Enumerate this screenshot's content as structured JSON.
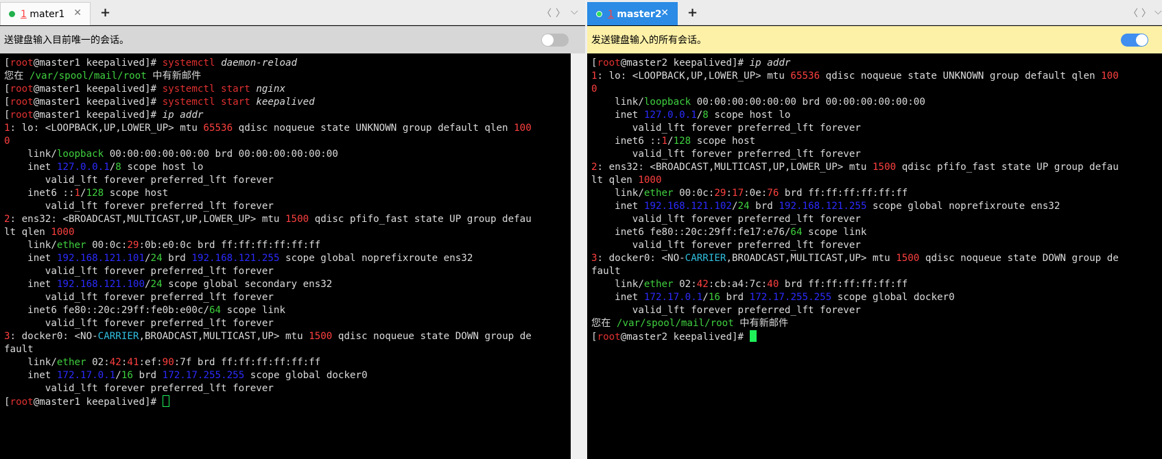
{
  "left": {
    "tab": {
      "num": "1",
      "name": "mater1"
    },
    "tab_close": "✕",
    "tab_add": "+",
    "nav": {
      "prev": "〈",
      "next": "〉",
      "menu": "⌵"
    },
    "broadcast_text": "送键盘输入目前唯一的会话。",
    "broadcast_on": false,
    "prompt": {
      "user": "root",
      "host": "@master1 keepalived"
    },
    "lines": [
      [
        [
          "br",
          "["
        ],
        [
          "root",
          "root"
        ],
        [
          "br",
          "@master1 keepalived]# "
        ],
        [
          "cmd",
          "systemctl "
        ],
        [
          "arg",
          "daemon-reload"
        ]
      ],
      [
        [
          "t",
          "您在 "
        ],
        [
          "grn",
          "/var/spool/mail/root"
        ],
        [
          "t",
          " 中有新邮件"
        ]
      ],
      [
        [
          "br",
          "["
        ],
        [
          "root",
          "root"
        ],
        [
          "br",
          "@master1 keepalived]# "
        ],
        [
          "cmd",
          "systemctl start "
        ],
        [
          "arg",
          "nginx"
        ]
      ],
      [
        [
          "br",
          "["
        ],
        [
          "root",
          "root"
        ],
        [
          "br",
          "@master1 keepalived]# "
        ],
        [
          "cmd",
          "systemctl start "
        ],
        [
          "arg",
          "keepalived"
        ]
      ],
      [
        [
          "br",
          "["
        ],
        [
          "root",
          "root"
        ],
        [
          "br",
          "@master1 keepalived]# "
        ],
        [
          "arg",
          "ip addr"
        ]
      ],
      [
        [
          "num",
          "1"
        ],
        [
          "t",
          ": lo: <LOOPBACK,UP,LOWER_UP> mtu "
        ],
        [
          "num",
          "65536"
        ],
        [
          "t",
          " qdisc noqueue state UNKNOWN group default qlen "
        ],
        [
          "num",
          "100"
        ]
      ],
      [
        [
          "num",
          "0"
        ]
      ],
      [
        [
          "t",
          "    link/"
        ],
        [
          "grn",
          "loopback"
        ],
        [
          "t",
          " 00:00:00:00:00:00 brd 00:00:00:00:00:00"
        ]
      ],
      [
        [
          "t",
          "    inet "
        ],
        [
          "blu",
          "127.0.0.1"
        ],
        [
          "t",
          "/"
        ],
        [
          "grn",
          "8"
        ],
        [
          "t",
          " scope host lo"
        ]
      ],
      [
        [
          "t",
          "       valid_lft forever preferred_lft forever"
        ]
      ],
      [
        [
          "t",
          "    inet6 ::"
        ],
        [
          "num",
          "1"
        ],
        [
          "t",
          "/"
        ],
        [
          "grn",
          "128"
        ],
        [
          "t",
          " scope host"
        ]
      ],
      [
        [
          "t",
          "       valid_lft forever preferred_lft forever"
        ]
      ],
      [
        [
          "num",
          "2"
        ],
        [
          "t",
          ": ens32: <BROADCAST,MULTICAST,UP,LOWER_UP> mtu "
        ],
        [
          "num",
          "1500"
        ],
        [
          "t",
          " qdisc pfifo_fast state UP group defau"
        ]
      ],
      [
        [
          "t",
          "lt qlen "
        ],
        [
          "num",
          "1000"
        ]
      ],
      [
        [
          "t",
          "    link/"
        ],
        [
          "grn",
          "ether"
        ],
        [
          "t",
          " 00:0c:"
        ],
        [
          "num",
          "29"
        ],
        [
          "t",
          ":0b:e0:0c brd ff:ff:ff:ff:ff:ff"
        ]
      ],
      [
        [
          "t",
          "    inet "
        ],
        [
          "blu",
          "192.168.121.101"
        ],
        [
          "t",
          "/"
        ],
        [
          "grn",
          "24"
        ],
        [
          "t",
          " brd "
        ],
        [
          "blu",
          "192.168.121.255"
        ],
        [
          "t",
          " scope global noprefixroute ens32"
        ]
      ],
      [
        [
          "t",
          "       valid_lft forever preferred_lft forever"
        ]
      ],
      [
        [
          "t",
          "    inet "
        ],
        [
          "blu",
          "192.168.121.100"
        ],
        [
          "t",
          "/"
        ],
        [
          "grn",
          "24"
        ],
        [
          "t",
          " scope global secondary ens32"
        ]
      ],
      [
        [
          "t",
          "       valid_lft forever preferred_lft forever"
        ]
      ],
      [
        [
          "t",
          "    inet6 fe80::20c:29ff:fe0b:e00c/"
        ],
        [
          "grn",
          "64"
        ],
        [
          "t",
          " scope link"
        ]
      ],
      [
        [
          "t",
          "       valid_lft forever preferred_lft forever"
        ]
      ],
      [
        [
          "num",
          "3"
        ],
        [
          "t",
          ": docker0: <NO-"
        ],
        [
          "cyan",
          "CARRIER"
        ],
        [
          "t",
          ",BROADCAST,MULTICAST,UP> mtu "
        ],
        [
          "num",
          "1500"
        ],
        [
          "t",
          " qdisc noqueue state DOWN group de"
        ]
      ],
      [
        [
          "t",
          "fault"
        ]
      ],
      [
        [
          "t",
          "    link/"
        ],
        [
          "grn",
          "ether"
        ],
        [
          "t",
          " 02:"
        ],
        [
          "num",
          "42"
        ],
        [
          "t",
          ":"
        ],
        [
          "num",
          "41"
        ],
        [
          "t",
          ":ef:"
        ],
        [
          "num",
          "90"
        ],
        [
          "t",
          ":7f brd ff:ff:ff:ff:ff:ff"
        ]
      ],
      [
        [
          "t",
          "    inet "
        ],
        [
          "blu",
          "172.17.0.1"
        ],
        [
          "t",
          "/"
        ],
        [
          "grn",
          "16"
        ],
        [
          "t",
          " brd "
        ],
        [
          "blu",
          "172.17.255.255"
        ],
        [
          "t",
          " scope global docker0"
        ]
      ],
      [
        [
          "t",
          "       valid_lft forever preferred_lft forever"
        ]
      ],
      [
        [
          "br",
          "["
        ],
        [
          "root",
          "root"
        ],
        [
          "br",
          "@master1 keepalived]# "
        ],
        [
          "cursor",
          ""
        ]
      ]
    ]
  },
  "right": {
    "tab": {
      "num": "1",
      "name": "master2"
    },
    "tab_close": "✕",
    "tab_add": "+",
    "nav": {
      "prev": "〈",
      "next": "〉",
      "menu": "⌵"
    },
    "broadcast_text": "发送键盘输入的所有会话。",
    "broadcast_on": true,
    "lines": [
      [
        [
          "br",
          "["
        ],
        [
          "root",
          "root"
        ],
        [
          "br",
          "@master2 keepalived]# "
        ],
        [
          "arg",
          "ip addr"
        ]
      ],
      [
        [
          "num",
          "1"
        ],
        [
          "t",
          ": lo: <LOOPBACK,UP,LOWER_UP> mtu "
        ],
        [
          "num",
          "65536"
        ],
        [
          "t",
          " qdisc noqueue state UNKNOWN group default qlen "
        ],
        [
          "num",
          "100"
        ]
      ],
      [
        [
          "num",
          "0"
        ]
      ],
      [
        [
          "t",
          "    link/"
        ],
        [
          "grn",
          "loopback"
        ],
        [
          "t",
          " 00:00:00:00:00:00 brd 00:00:00:00:00:00"
        ]
      ],
      [
        [
          "t",
          "    inet "
        ],
        [
          "blu",
          "127.0.0.1"
        ],
        [
          "t",
          "/"
        ],
        [
          "grn",
          "8"
        ],
        [
          "t",
          " scope host lo"
        ]
      ],
      [
        [
          "t",
          "       valid_lft forever preferred_lft forever"
        ]
      ],
      [
        [
          "t",
          "    inet6 ::"
        ],
        [
          "num",
          "1"
        ],
        [
          "t",
          "/"
        ],
        [
          "grn",
          "128"
        ],
        [
          "t",
          " scope host"
        ]
      ],
      [
        [
          "t",
          "       valid_lft forever preferred_lft forever"
        ]
      ],
      [
        [
          "num",
          "2"
        ],
        [
          "t",
          ": ens32: <BROADCAST,MULTICAST,UP,LOWER_UP> mtu "
        ],
        [
          "num",
          "1500"
        ],
        [
          "t",
          " qdisc pfifo_fast state UP group defau"
        ]
      ],
      [
        [
          "t",
          "lt qlen "
        ],
        [
          "num",
          "1000"
        ]
      ],
      [
        [
          "t",
          "    link/"
        ],
        [
          "grn",
          "ether"
        ],
        [
          "t",
          " 00:0c:"
        ],
        [
          "num",
          "29"
        ],
        [
          "t",
          ":"
        ],
        [
          "num",
          "17"
        ],
        [
          "t",
          ":0e:"
        ],
        [
          "num",
          "76"
        ],
        [
          "t",
          " brd ff:ff:ff:ff:ff:ff"
        ]
      ],
      [
        [
          "t",
          "    inet "
        ],
        [
          "blu",
          "192.168.121.102"
        ],
        [
          "t",
          "/"
        ],
        [
          "grn",
          "24"
        ],
        [
          "t",
          " brd "
        ],
        [
          "blu",
          "192.168.121.255"
        ],
        [
          "t",
          " scope global noprefixroute ens32"
        ]
      ],
      [
        [
          "t",
          "       valid_lft forever preferred_lft forever"
        ]
      ],
      [
        [
          "t",
          "    inet6 fe80::20c:29ff:fe17:e76/"
        ],
        [
          "grn",
          "64"
        ],
        [
          "t",
          " scope link"
        ]
      ],
      [
        [
          "t",
          "       valid_lft forever preferred_lft forever"
        ]
      ],
      [
        [
          "num",
          "3"
        ],
        [
          "t",
          ": docker0: <NO-"
        ],
        [
          "cyan",
          "CARRIER"
        ],
        [
          "t",
          ",BROADCAST,MULTICAST,UP> mtu "
        ],
        [
          "num",
          "1500"
        ],
        [
          "t",
          " qdisc noqueue state DOWN group de"
        ]
      ],
      [
        [
          "t",
          "fault"
        ]
      ],
      [
        [
          "t",
          "    link/"
        ],
        [
          "grn",
          "ether"
        ],
        [
          "t",
          " 02:"
        ],
        [
          "num",
          "42"
        ],
        [
          "t",
          ":cb:a4:7c:"
        ],
        [
          "num",
          "40"
        ],
        [
          "t",
          " brd ff:ff:ff:ff:ff:ff"
        ]
      ],
      [
        [
          "t",
          "    inet "
        ],
        [
          "blu",
          "172.17.0.1"
        ],
        [
          "t",
          "/"
        ],
        [
          "grn",
          "16"
        ],
        [
          "t",
          " brd "
        ],
        [
          "blu",
          "172.17.255.255"
        ],
        [
          "t",
          " scope global docker0"
        ]
      ],
      [
        [
          "t",
          "       valid_lft forever preferred_lft forever"
        ]
      ],
      [
        [
          "t",
          "您在 "
        ],
        [
          "grn",
          "/var/spool/mail/root"
        ],
        [
          "t",
          " 中有新邮件"
        ]
      ],
      [
        [
          "br",
          "["
        ],
        [
          "root",
          "root"
        ],
        [
          "br",
          "@master2 keepalived]# "
        ],
        [
          "cursor",
          ""
        ]
      ]
    ]
  },
  "colors": {
    "active_tab": "#2b8be5",
    "status_dot": "#22b14c",
    "prompt_root": "#e03030",
    "number": "#ff4040",
    "path_green": "#3fd03f",
    "ip_blue": "#2b2bff",
    "cursor": "#1ff05a",
    "broadcast_bar_left": "#d7d7d7",
    "broadcast_bar_right": "#fdf1a8"
  }
}
